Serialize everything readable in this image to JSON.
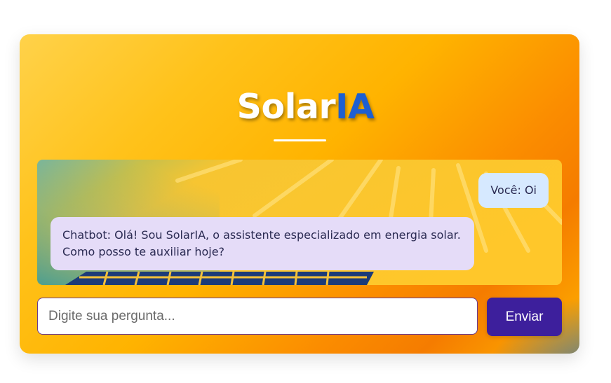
{
  "app": {
    "title_main": "Solar",
    "title_accent": "IA"
  },
  "chat": {
    "messages": [
      {
        "role": "user",
        "text": "Você: Oi"
      },
      {
        "role": "bot",
        "text": "Chatbot: Olá! Sou SolarIA, o assistente especializado em energia solar. Como posso te auxiliar hoje?"
      }
    ]
  },
  "composer": {
    "placeholder": "Digite sua pergunta...",
    "value": "",
    "send_label": "Enviar"
  },
  "colors": {
    "accent": "#1d5fd1",
    "button": "#3d1f9c",
    "user_bubble": "#d6e9ff",
    "bot_bubble": "#e5dcf8"
  }
}
